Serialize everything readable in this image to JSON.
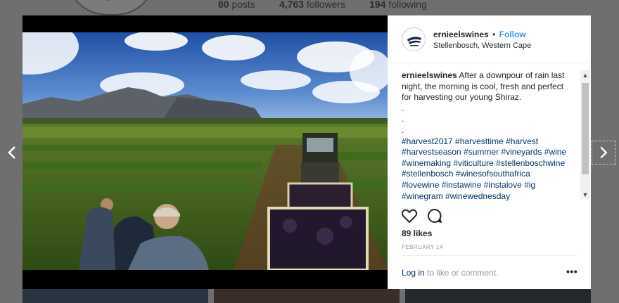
{
  "background": {
    "stats": [
      {
        "count": "80",
        "label": "posts"
      },
      {
        "count": "4,763",
        "label": "followers"
      },
      {
        "count": "194",
        "label": "following"
      }
    ]
  },
  "post": {
    "username": "ernieelswines",
    "separator": "•",
    "follow_label": "Follow",
    "location": "Stellenbosch, Western Cape",
    "caption_text": "After a downpour of rain last night, the morning is cool, fresh and perfect for harvesting our young Shiraz.",
    "caption_dots": [
      ".",
      ".",
      "."
    ],
    "hashtags": "#harvest2017 #harvesttime #harvest #harvestseason #summer #vineyards #wine #winemaking #viticulture #stellenboschwine #stellenbosch #winesofsouthafrica #lovewine #instawine #instalove #ig #winegram #winewednesday",
    "likes": "89 likes",
    "date": "FEBRUARY 14",
    "login_link": "Log in",
    "comment_prompt": " to like or comment.",
    "more_label": "•••"
  },
  "icons": {
    "like": "heart-icon",
    "comment": "comment-icon",
    "prev": "chevron-left-icon",
    "next": "chevron-right-icon"
  },
  "colors": {
    "follow": "#3897f0",
    "hashtag": "#003569",
    "muted": "#999999"
  }
}
